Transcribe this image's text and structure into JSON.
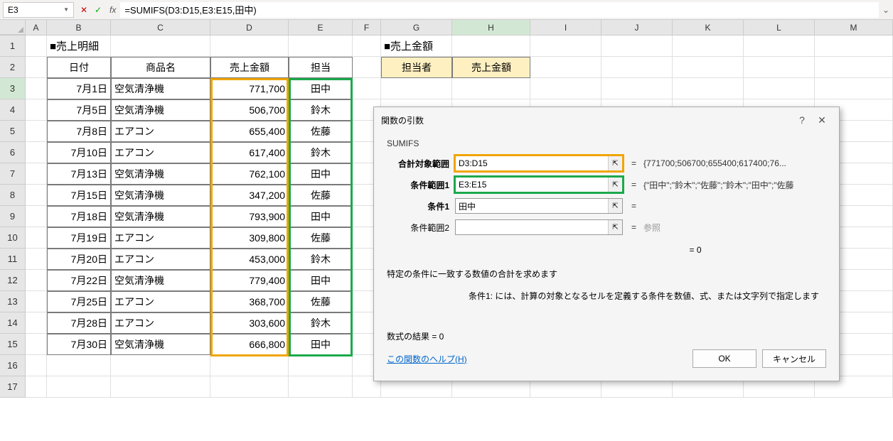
{
  "namebox": "E3",
  "formula": "=SUMIFS(D3:D15,E3:E15,田中)",
  "columns": [
    "A",
    "B",
    "C",
    "D",
    "E",
    "F",
    "G",
    "H",
    "I",
    "J",
    "K",
    "L",
    "M"
  ],
  "title_left": "■売上明細",
  "title_right": "■売上金額",
  "left_headers": [
    "日付",
    "商品名",
    "売上金額",
    "担当"
  ],
  "right_headers": [
    "担当者",
    "売上金額"
  ],
  "rows": [
    {
      "date": "7月1日",
      "item": "空気清浄機",
      "amount": "771,700",
      "rep": "田中"
    },
    {
      "date": "7月5日",
      "item": "空気清浄機",
      "amount": "506,700",
      "rep": "鈴木"
    },
    {
      "date": "7月8日",
      "item": "エアコン",
      "amount": "655,400",
      "rep": "佐藤"
    },
    {
      "date": "7月10日",
      "item": "エアコン",
      "amount": "617,400",
      "rep": "鈴木"
    },
    {
      "date": "7月13日",
      "item": "空気清浄機",
      "amount": "762,100",
      "rep": "田中"
    },
    {
      "date": "7月15日",
      "item": "空気清浄機",
      "amount": "347,200",
      "rep": "佐藤"
    },
    {
      "date": "7月18日",
      "item": "空気清浄機",
      "amount": "793,900",
      "rep": "田中"
    },
    {
      "date": "7月19日",
      "item": "エアコン",
      "amount": "309,800",
      "rep": "佐藤"
    },
    {
      "date": "7月20日",
      "item": "エアコン",
      "amount": "453,000",
      "rep": "鈴木"
    },
    {
      "date": "7月22日",
      "item": "空気清浄機",
      "amount": "779,400",
      "rep": "田中"
    },
    {
      "date": "7月25日",
      "item": "エアコン",
      "amount": "368,700",
      "rep": "佐藤"
    },
    {
      "date": "7月28日",
      "item": "エアコン",
      "amount": "303,600",
      "rep": "鈴木"
    },
    {
      "date": "7月30日",
      "item": "空気清浄機",
      "amount": "666,800",
      "rep": "田中"
    }
  ],
  "dialog": {
    "title": "関数の引数",
    "fn": "SUMIFS",
    "args": [
      {
        "label": "合計対象範囲",
        "value": "D3:D15",
        "result": "{771700;506700;655400;617400;76...",
        "hl": "orange",
        "bold": true
      },
      {
        "label": "条件範囲1",
        "value": "E3:E15",
        "result": "{\"田中\";\"鈴木\";\"佐藤\";\"鈴木\";\"田中\";\"佐藤",
        "hl": "green",
        "bold": true
      },
      {
        "label": "条件1",
        "value": "田中|",
        "result": "",
        "hl": "",
        "bold": true
      },
      {
        "label": "条件範囲2",
        "value": "",
        "result": "参照",
        "hl": "",
        "bold": false
      }
    ],
    "final_eq": "=   0",
    "desc1": "特定の条件に一致する数値の合計を求めます",
    "desc2": "条件1:  には、計算の対象となるセルを定義する条件を数値、式、または文字列で指定します",
    "result_line": "数式の結果 =   0",
    "help": "この関数のヘルプ(H)",
    "ok": "OK",
    "cancel": "キャンセル"
  }
}
